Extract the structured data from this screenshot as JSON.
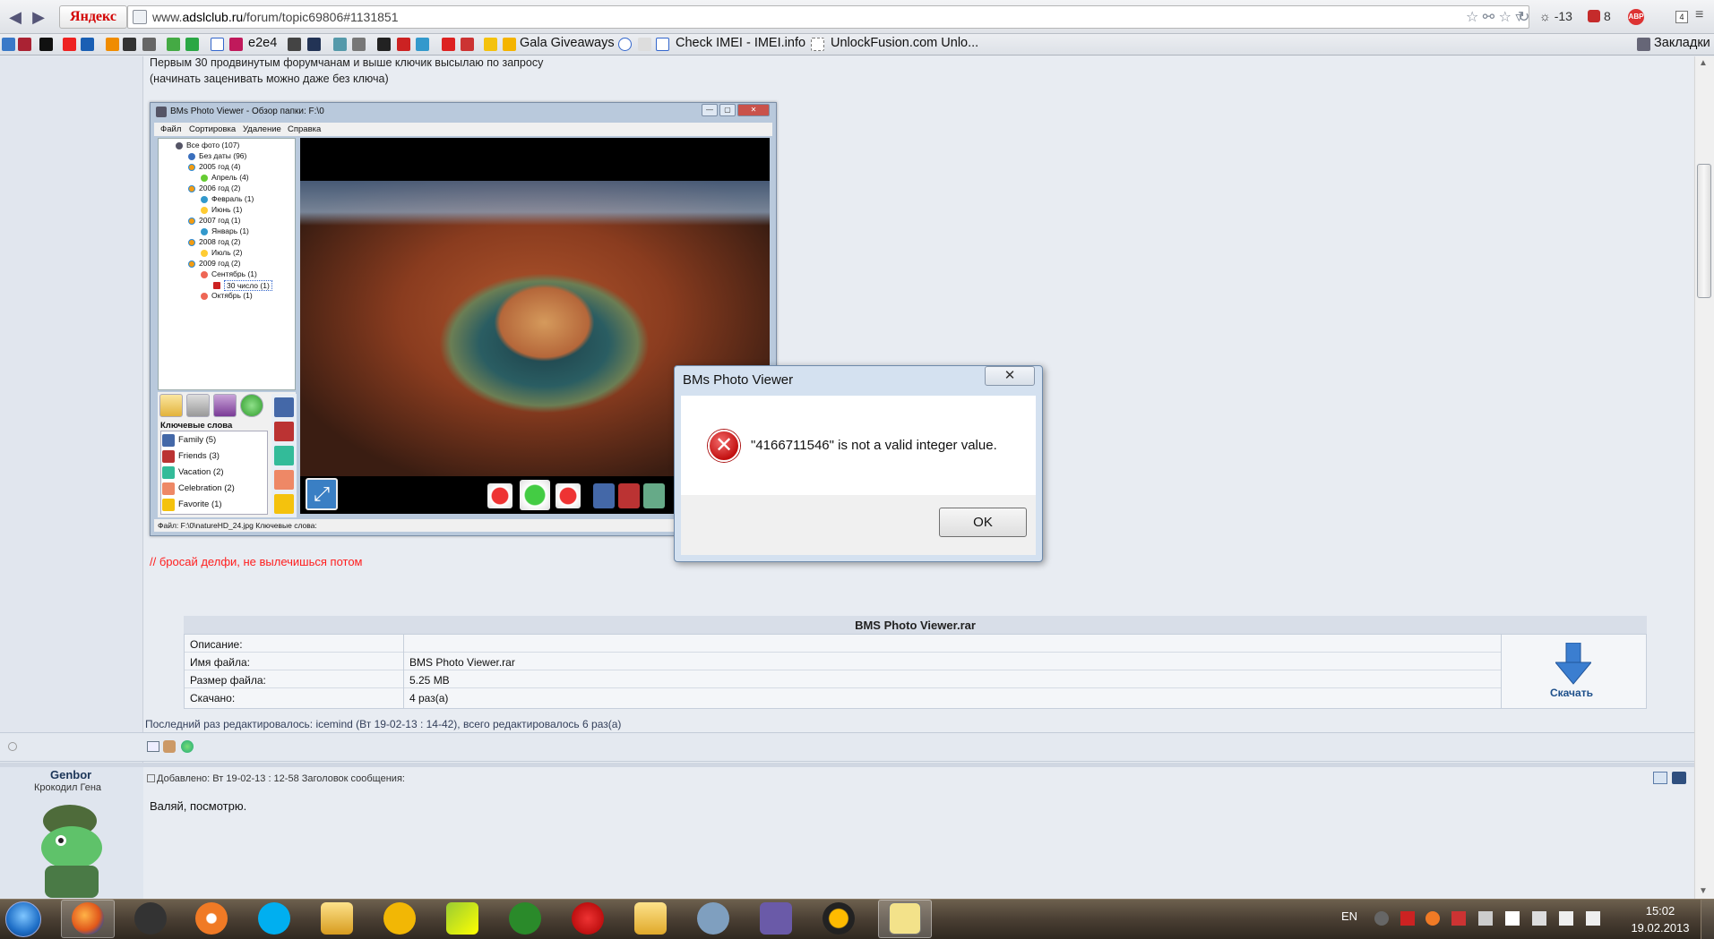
{
  "browser": {
    "search_brand": "Яндекс",
    "url_prefix": "www.",
    "url_domain": "adslclub.ru",
    "url_path": "/forum/topic69806#1131851",
    "weather": "-13",
    "mail_count": "8",
    "abp_label": "ABP",
    "tab_count": "4",
    "bookmarks": {
      "e2e4": "e2e4",
      "gala": "Gala Giveaways",
      "imei": "Check IMEI - IMEI.info",
      "unlock": "UnlockFusion.com Unlo...",
      "folder": "Закладки"
    }
  },
  "post_top": {
    "line1": "Первым 30 продвинутым форумчанам и выше ключик высылаю по запросу",
    "line2": "(начинать заценивать можно даже без ключа)",
    "red_note": "// бросай делфи, не вылечишься потом"
  },
  "embedded_app": {
    "title": "BMs Photo Viewer - Обзор папки: F:\\0",
    "menu": [
      "Файл",
      "Сортировка",
      "Удаление",
      "Справка"
    ],
    "tree": [
      {
        "label": "Все фото (107)"
      },
      {
        "label": "Без даты (96)"
      },
      {
        "label": "2005 год (4)"
      },
      {
        "label": "Апрель (4)"
      },
      {
        "label": "2006 год (2)"
      },
      {
        "label": "Февраль (1)"
      },
      {
        "label": "Июнь (1)"
      },
      {
        "label": "2007 год (1)"
      },
      {
        "label": "Январь (1)"
      },
      {
        "label": "2008 год (2)"
      },
      {
        "label": "Июль (2)"
      },
      {
        "label": "2009 год (2)"
      },
      {
        "label": "Сентябрь (1)"
      },
      {
        "label": "30 число (1)"
      },
      {
        "label": "Октябрь (1)"
      }
    ],
    "keywords_header": "Ключевые слова",
    "keywords": [
      "Family (5)",
      "Friends (3)",
      "Vacation (2)",
      "Celebration (2)",
      "Favorite (1)"
    ],
    "status": "Файл: F:\\0\\natureHD_24.jpg  Ключевые слова:"
  },
  "dialog": {
    "title": "BMs Photo Viewer",
    "close_glyph": "✕",
    "error_glyph": "✕",
    "message": "\"4166711546\" is not a valid integer value.",
    "ok": "OK"
  },
  "attachment": {
    "title": "BMS Photo Viewer.rar",
    "rows": [
      {
        "label": "Описание:",
        "value": ""
      },
      {
        "label": "Имя файла:",
        "value": "BMS Photo Viewer.rar"
      },
      {
        "label": "Размер файла:",
        "value": "5.25 MB"
      },
      {
        "label": "Скачано:",
        "value": "4 раз(а)"
      }
    ],
    "download_label": "Скачать"
  },
  "last_edit": "Последний раз редактировалось: icemind (Вт 19-02-13 : 14-42), всего редактировалось 6 раз(а)",
  "next_post": {
    "author": "Genbor",
    "rank": "Крокодил Гена",
    "header": "Добавлено: Вт 19-02-13 : 12-58     Заголовок сообщения:",
    "text": "Валяй, посмотрю."
  },
  "taskbar": {
    "lang": "EN",
    "time": "15:02",
    "date": "19.02.2013"
  },
  "colors": {
    "red_note": "#ff1e1e",
    "link_blue": "#1d4f8a",
    "error_red": "#c21010"
  }
}
